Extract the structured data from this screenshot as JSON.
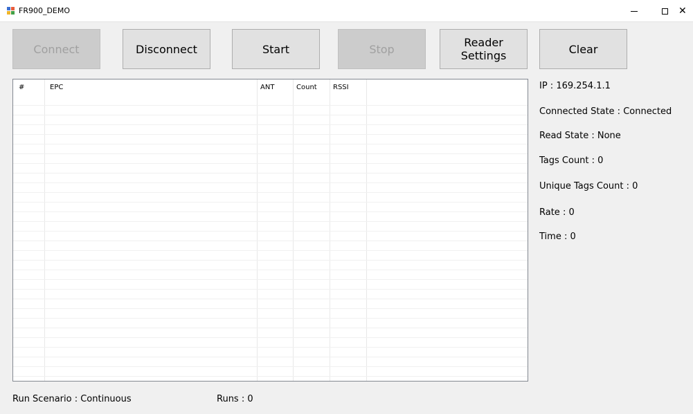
{
  "window": {
    "title": "FR900_DEMO",
    "minimize": "–",
    "maximize": "□",
    "close": "✕"
  },
  "toolbar": {
    "connect_label": "Connect",
    "disconnect_label": "Disconnect",
    "start_label": "Start",
    "stop_label": "Stop",
    "reader_settings_label": "Reader\nSettings",
    "clear_label": "Clear"
  },
  "list": {
    "columns": [
      "#",
      "EPC",
      "ANT",
      "Count",
      "RSSI"
    ],
    "rows": []
  },
  "info": {
    "ip": "IP : 169.254.1.1",
    "connected_state": "Connected State : Connected",
    "read_state": "Read State : None",
    "tags_count": "Tags Count : 0",
    "unique_tags_count": "Unique Tags Count : 0",
    "rate": "Rate : 0",
    "time": "Time : 0"
  },
  "status": {
    "run_scenario": "Run Scenario : Continuous",
    "runs": "Runs : 0"
  },
  "colors": {
    "window_bg": "#f0f0f0",
    "button_bg": "#e1e1e1",
    "button_disabled_bg": "#cccccc",
    "button_disabled_text": "#a0a0a0",
    "grid_line": "#e8e8e8"
  }
}
